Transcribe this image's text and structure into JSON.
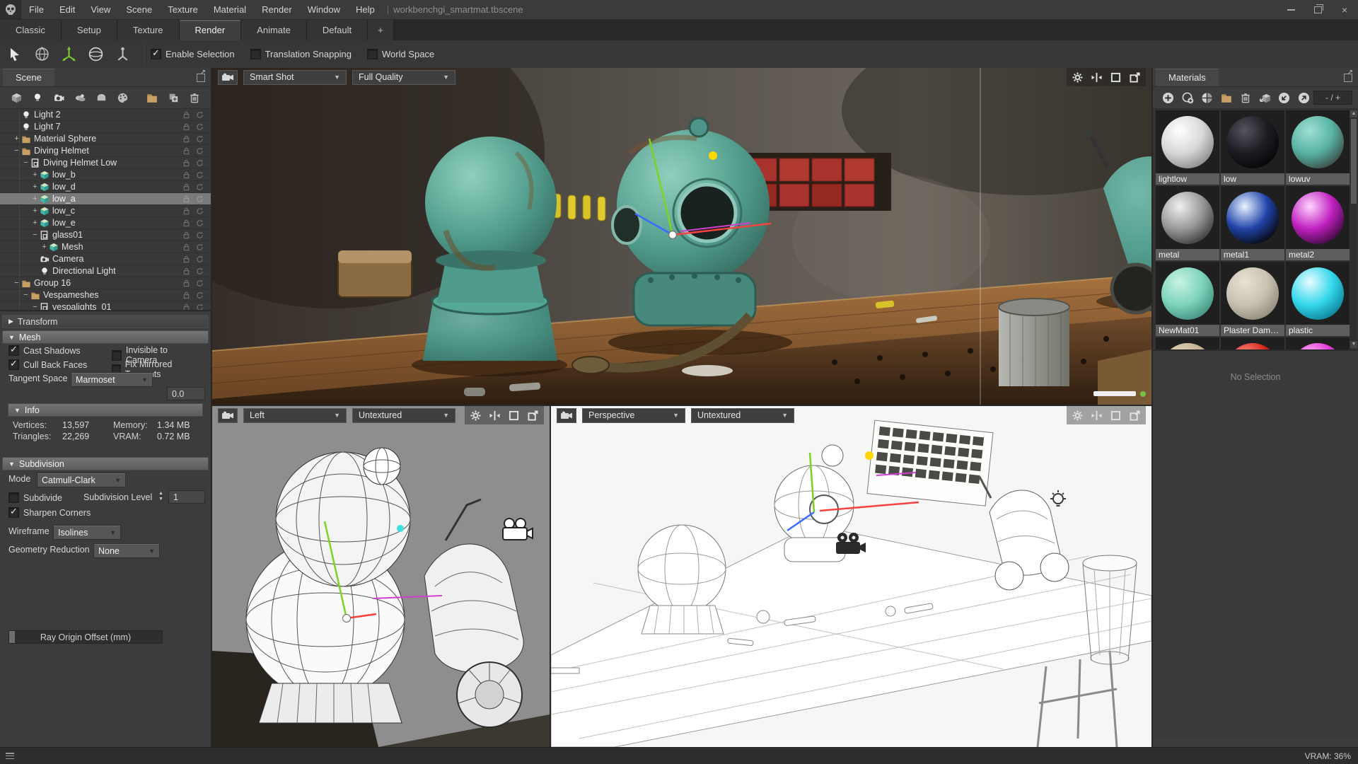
{
  "app": {
    "title_file": "workbenchgi_smartmat.tbscene",
    "vram": "VRAM: 36%"
  },
  "menubar": {
    "items": [
      "File",
      "Edit",
      "View",
      "Scene",
      "Texture",
      "Material",
      "Render",
      "Window",
      "Help"
    ],
    "separator": "|"
  },
  "layout_tabs": {
    "items": [
      "Classic",
      "Setup",
      "Texture",
      "Render",
      "Animate",
      "Default",
      "+"
    ],
    "active": "Render"
  },
  "tool_options": {
    "enable_selection": {
      "label": "Enable Selection",
      "checked": true
    },
    "translation_snapping": {
      "label": "Translation Snapping",
      "checked": false
    },
    "world_space": {
      "label": "World Space",
      "checked": false
    }
  },
  "scene_panel": {
    "title": "Scene",
    "tree": [
      {
        "label": "Light 2",
        "icon": "bulb",
        "depth": 1,
        "expander": "",
        "selected": false
      },
      {
        "label": "Light 7",
        "icon": "bulb",
        "depth": 1,
        "expander": "",
        "selected": false
      },
      {
        "label": "Material Sphere",
        "icon": "folder",
        "depth": 1,
        "expander": "+",
        "selected": false
      },
      {
        "label": "Diving Helmet",
        "icon": "folder",
        "depth": 1,
        "expander": "-",
        "selected": false
      },
      {
        "label": "Diving Helmet Low",
        "icon": "model",
        "depth": 2,
        "expander": "-",
        "selected": false
      },
      {
        "label": "low_b",
        "icon": "cube",
        "depth": 3,
        "expander": "+",
        "selected": false
      },
      {
        "label": "low_d",
        "icon": "cube",
        "depth": 3,
        "expander": "+",
        "selected": false
      },
      {
        "label": "low_a",
        "icon": "cube",
        "depth": 3,
        "expander": "+",
        "selected": true
      },
      {
        "label": "low_c",
        "icon": "cube",
        "depth": 3,
        "expander": "+",
        "selected": false
      },
      {
        "label": "low_e",
        "icon": "cube",
        "depth": 3,
        "expander": "+",
        "selected": false
      },
      {
        "label": "glass01",
        "icon": "model",
        "depth": 3,
        "expander": "-",
        "selected": false
      },
      {
        "label": "Mesh",
        "icon": "cube",
        "depth": 4,
        "expander": "+",
        "selected": false
      },
      {
        "label": "Camera",
        "icon": "camera",
        "depth": 3,
        "expander": "",
        "selected": false
      },
      {
        "label": "Directional Light",
        "icon": "bulb",
        "depth": 3,
        "expander": "",
        "selected": false
      },
      {
        "label": "Group 16",
        "icon": "folder",
        "depth": 1,
        "expander": "-",
        "selected": false
      },
      {
        "label": "Vespameshes",
        "icon": "folder",
        "depth": 2,
        "expander": "-",
        "selected": false
      },
      {
        "label": "vespalights_01",
        "icon": "model",
        "depth": 3,
        "expander": "-",
        "selected": false
      },
      {
        "label": "",
        "icon": "cube",
        "depth": 4,
        "expander": "+",
        "selected": false
      }
    ]
  },
  "transform_panel": {
    "title": "Transform"
  },
  "mesh_panel": {
    "title": "Mesh",
    "cast_shadows": {
      "label": "Cast Shadows",
      "checked": true
    },
    "invisible_to_camera": {
      "label": "Invisible to Camera",
      "checked": false
    },
    "cull_back_faces": {
      "label": "Cull Back Faces",
      "checked": true
    },
    "fix_mirrored_tangents": {
      "label": "Fix Mirrored Tangents",
      "checked": false
    },
    "tangent_space_label": "Tangent Space",
    "tangent_space_value": "Marmoset",
    "ray_origin_label": "Ray Origin Offset (mm)",
    "ray_origin_value": "0.0",
    "info_title": "Info",
    "vertices_label": "Vertices:",
    "vertices_value": "13,597",
    "triangles_label": "Triangles:",
    "triangles_value": "22,269",
    "memory_label": "Memory:",
    "memory_value": "1.34 MB",
    "vram_label": "VRAM:",
    "vram_value": "0.72 MB"
  },
  "subdivision_panel": {
    "title": "Subdivision",
    "mode_label": "Mode",
    "mode_value": "Catmull-Clark",
    "subdivide": {
      "label": "Subdivide",
      "checked": false
    },
    "subdivision_level_label": "Subdivision Level",
    "subdivision_level_value": "1",
    "sharpen_corners": {
      "label": "Sharpen Corners",
      "checked": true
    },
    "wireframe_label": "Wireframe",
    "wireframe_value": "Isolines",
    "geometry_reduction_label": "Geometry Reduction",
    "geometry_reduction_value": "None"
  },
  "viewports": {
    "main": {
      "camera": "Smart Shot",
      "quality": "Full Quality"
    },
    "left": {
      "view": "Left",
      "shading": "Untextured"
    },
    "perspective": {
      "view": "Perspective",
      "shading": "Untextured"
    },
    "gizmo_colors": {
      "x": "#ff4040",
      "y": "#7ed321",
      "z": "#3a6cff",
      "highlight": "#ffd800",
      "extra": "#d040d0"
    }
  },
  "materials_panel": {
    "title": "Materials",
    "size_field": "- / +",
    "no_selection": "No Selection",
    "items": [
      {
        "name": "lightlow",
        "colors": [
          "#ffffff",
          "#d8d8d8",
          "#8a8a8a"
        ]
      },
      {
        "name": "low",
        "colors": [
          "#55555f",
          "#1c1c22",
          "#060608"
        ]
      },
      {
        "name": "lowuv",
        "colors": [
          "#9fe0d4",
          "#58b3a4",
          "#3a4a44"
        ]
      },
      {
        "name": "metal",
        "colors": [
          "#f0f0f0",
          "#9a9a9a",
          "#3a3a3a"
        ]
      },
      {
        "name": "metal1",
        "colors": [
          "#e8f4ff",
          "#2244aa",
          "#05070f"
        ]
      },
      {
        "name": "metal2",
        "colors": [
          "#ffd6ff",
          "#c020c0",
          "#3c0a3c"
        ]
      },
      {
        "name": "NewMat01",
        "colors": [
          "#c9f2e4",
          "#7fd4bd",
          "#3f8f7c"
        ]
      },
      {
        "name": "Plaster Dam…",
        "colors": [
          "#e8e2d4",
          "#c9c2b2",
          "#8f897b"
        ]
      },
      {
        "name": "plastic",
        "colors": [
          "#eafcff",
          "#35d8ec",
          "#0b7f95"
        ]
      },
      {
        "name": "",
        "colors": [
          "#e6d9bd",
          "#c4b193",
          "#8a7a5c"
        ]
      },
      {
        "name": "",
        "colors": [
          "#ff9a8a",
          "#d42018",
          "#6a0c08"
        ]
      },
      {
        "name": "",
        "colors": [
          "#ffc2f5",
          "#e034d4",
          "#70106a"
        ]
      }
    ]
  },
  "icons": {
    "window": [
      "minimize",
      "restore",
      "close"
    ],
    "scene_toolbar": [
      "add-object",
      "add-light",
      "add-camera",
      "add-sky",
      "add-shadow-catcher",
      "add-material",
      "new-folder",
      "duplicate",
      "delete"
    ],
    "materials_toolbar": [
      "new-material",
      "duplicate-material",
      "refresh-thumbnails",
      "new-folder",
      "delete-material",
      "assign-to-selection",
      "import-library",
      "export-library"
    ]
  }
}
